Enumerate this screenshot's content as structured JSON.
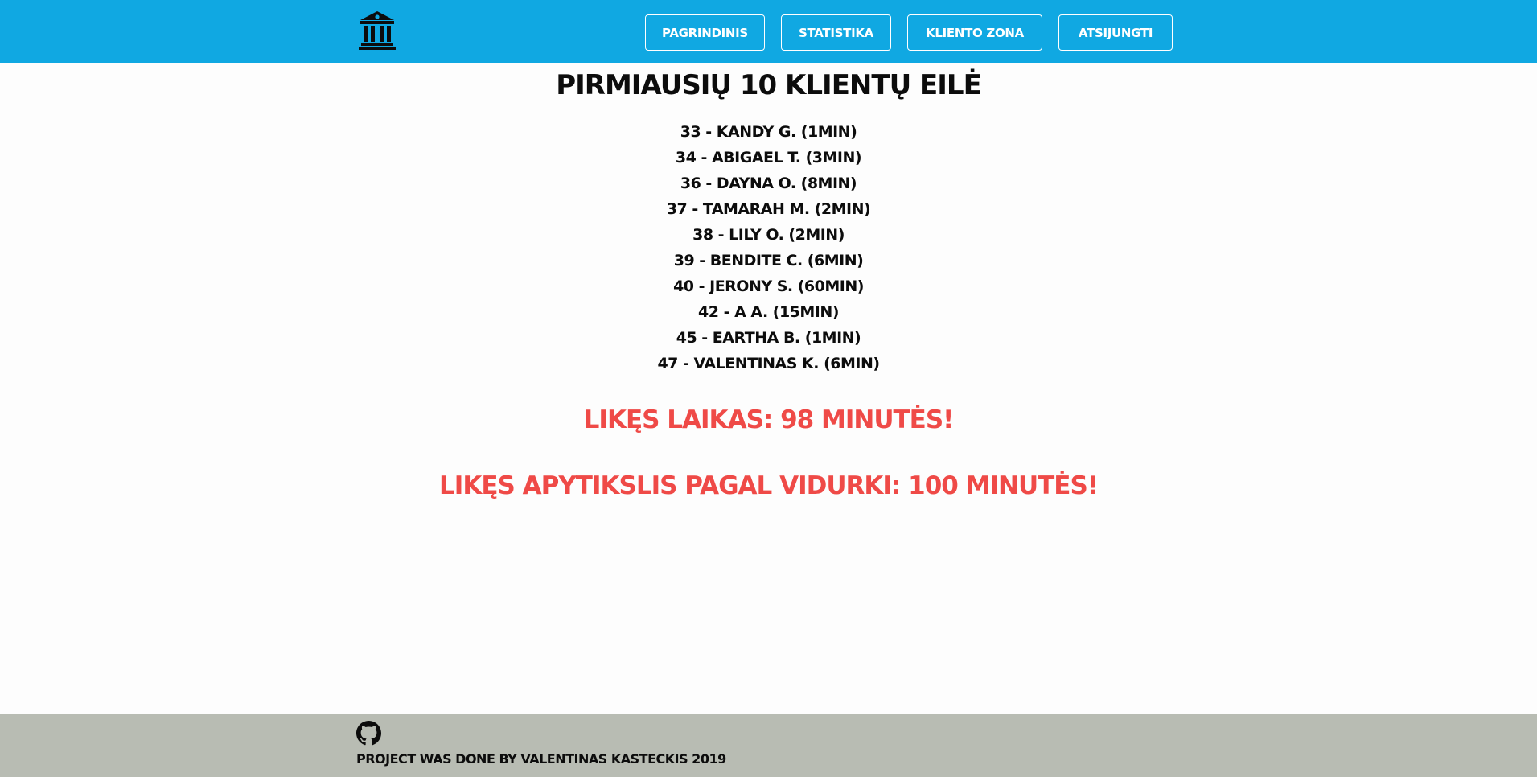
{
  "nav": {
    "logo_icon": "bank-icon",
    "items": [
      {
        "label": "PAGRINDINIS"
      },
      {
        "label": "STATISTIKA"
      },
      {
        "label": "KLIENTO ZONA"
      },
      {
        "label": "ATSIJUNGTI"
      }
    ]
  },
  "main": {
    "title": "PIRMIAUSIŲ 10 KLIENTŲ EILĖ",
    "queue": [
      "33 - KANDY G. (1MIN)",
      "34 - ABIGAEL T. (3MIN)",
      "36 - DAYNA O. (8MIN)",
      "37 - TAMARAH M. (2MIN)",
      "38 - LILY O. (2MIN)",
      "39 - BENDITE C. (6MIN)",
      "40 - JERONY S. (60MIN)",
      "42 - A A. (15MIN)",
      "45 - EARTHA B. (1MIN)",
      "47 - VALENTINAS K. (6MIN)"
    ],
    "remaining_time": "LIKĘS LAIKAS: 98 MINUTĖS!",
    "estimated_time": "LIKĘS APYTIKSLIS PAGAL VIDURKI: 100 MINUTĖS!"
  },
  "footer": {
    "icon": "github-icon",
    "credit": "PROJECT WAS DONE BY VALENTINAS KASTECKIS 2019"
  },
  "colors": {
    "navbar": "#10a8e2",
    "accent_red": "#ef4a47",
    "footer": "#b8bcb3"
  }
}
